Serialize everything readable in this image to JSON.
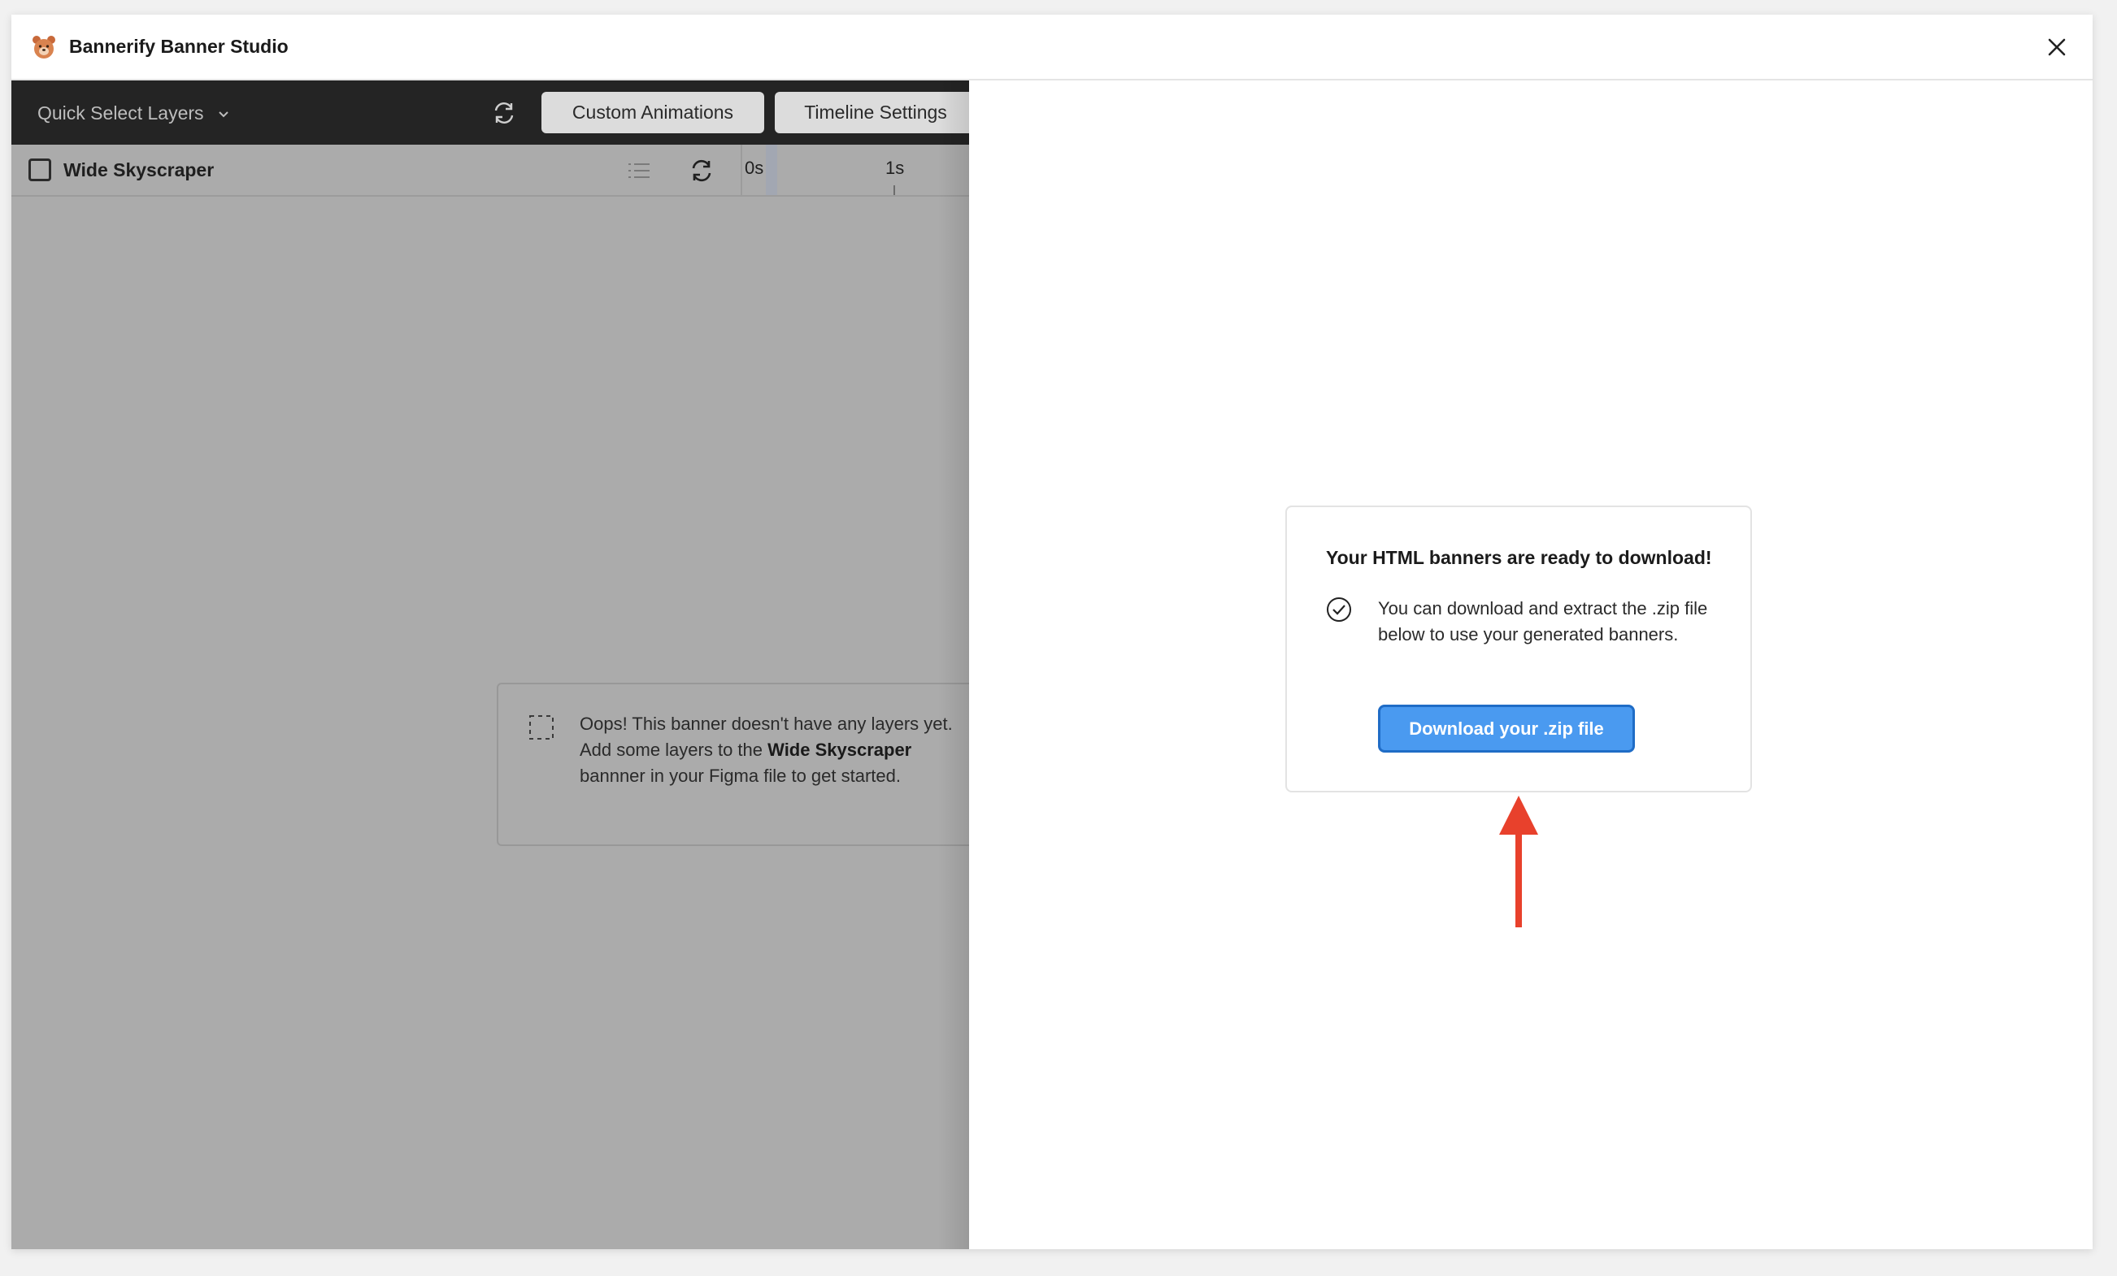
{
  "app": {
    "title": "Bannerify Banner Studio",
    "logo_icon": "bear-logo-icon",
    "close_icon": "close-icon"
  },
  "toolbar": {
    "quick_select_label": "Quick Select Layers",
    "refresh_icon": "refresh-icon",
    "custom_animations_label": "Custom Animations",
    "timeline_settings_label": "Timeline Settings"
  },
  "layer_row": {
    "name": "Wide Skyscraper",
    "checked": false,
    "timeline_labels": [
      "0s",
      "1s"
    ]
  },
  "empty_state": {
    "text_part1": "Oops! This banner doesn't have any layers yet. Add some layers to the ",
    "bold_name": "Wide Skyscraper",
    "text_part2": " bannner in your Figma file to get started."
  },
  "download": {
    "title": "Your HTML banners are ready to download!",
    "description": "You can download and extract the .zip file below to use your generated banners.",
    "button_label": "Download your .zip file"
  },
  "colors": {
    "accent_blue": "#4a9af0",
    "toolbar_dark": "#242424",
    "annotation_red": "#e8412c"
  }
}
